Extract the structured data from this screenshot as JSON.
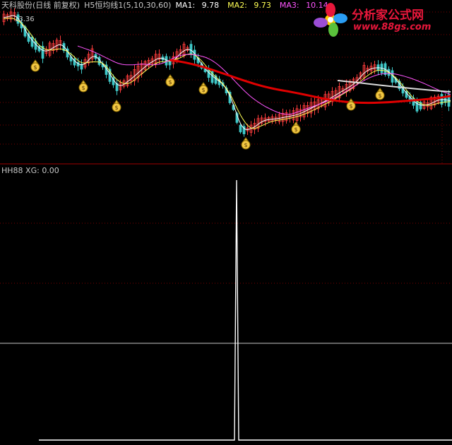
{
  "header": {
    "stock_name": "天科股份(日线 前复权)",
    "indicator_name": "H5恒均线1(5,10,30,60)",
    "ma1_label": "MA1:",
    "ma1_value": "9.78",
    "ma2_label": "MA2:",
    "ma2_value": "9.73",
    "ma3_label": "MA3:",
    "ma3_value": "10.14"
  },
  "price_label": "13.36",
  "lower_panel": {
    "indicator_name": "HH88",
    "xg_label": "XG:",
    "xg_value": "0.00"
  },
  "brand": {
    "name": "分析家公式网",
    "url": "www.88gs.com"
  },
  "colors": {
    "background": "#000000",
    "grid": "#7a0000",
    "divider": "#a00000",
    "up_candle": "#ff3c3c",
    "down_candle": "#3fc8c8",
    "ma1": "#ffffff",
    "ma2": "#ffff55",
    "ma3": "#ff55ff",
    "ma4": "#e00000",
    "signal": "#ffffff",
    "header_text": "#c8c8c8",
    "brand": "#e8173b"
  },
  "icons": {
    "buy_marker": "money-bag-icon",
    "logo": "pinwheel-logo-icon"
  }
}
